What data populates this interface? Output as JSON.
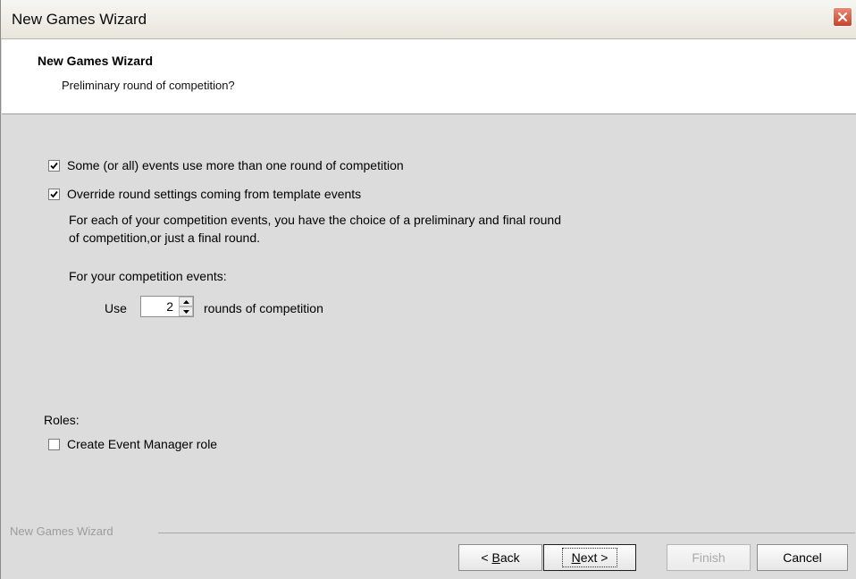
{
  "window": {
    "title": "New Games Wizard"
  },
  "header": {
    "title": "New Games Wizard",
    "subtitle": "Preliminary round of competition?"
  },
  "options": {
    "multi_round": {
      "label": "Some (or all) events use more than one round of competition",
      "checked": true
    },
    "override": {
      "label": "Override round settings coming from template events",
      "checked": true
    }
  },
  "description": {
    "line1": "For each of your competition events, you have the choice of a preliminary and final round",
    "line2": "of competition,or just a final round."
  },
  "rounds": {
    "prompt": "For your competition events:",
    "use_label": "Use",
    "value": "2",
    "suffix": "rounds of competition"
  },
  "roles": {
    "heading": "Roles:",
    "event_manager": {
      "label": "Create Event Manager role",
      "checked": false
    }
  },
  "footer": {
    "label": "New Games Wizard",
    "back": {
      "prefix": "< ",
      "mnemonic": "B",
      "rest": "ack"
    },
    "next": {
      "mnemonic": "N",
      "rest": "ext >"
    },
    "finish": "Finish",
    "cancel": "Cancel"
  }
}
